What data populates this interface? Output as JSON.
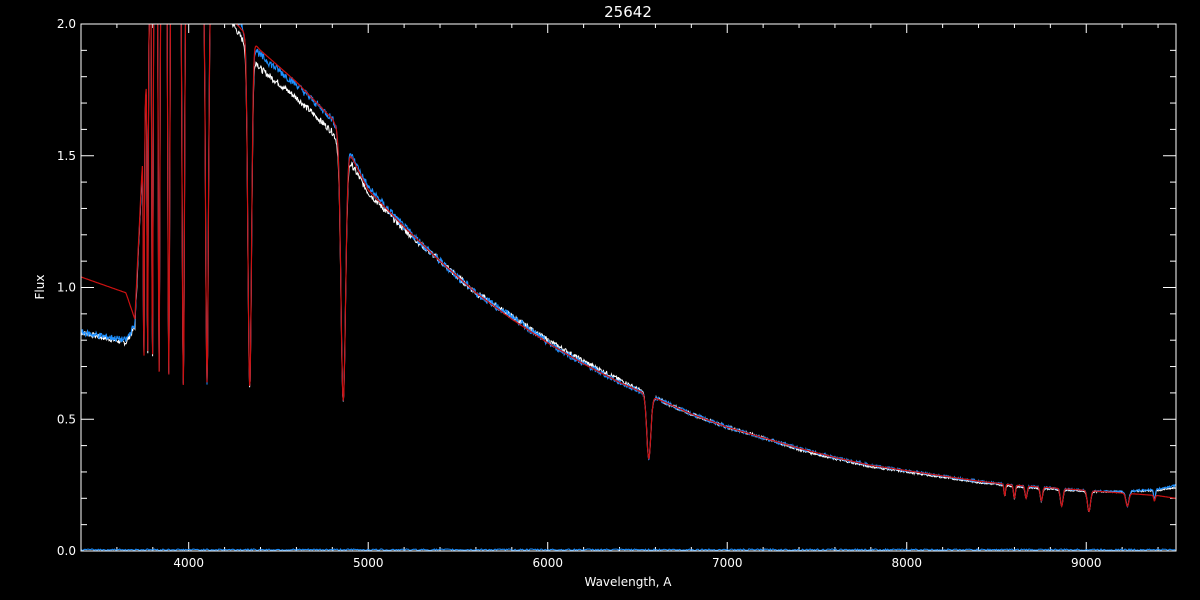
{
  "chart_data": {
    "type": "line",
    "title": "25642",
    "xlabel": "Wavelength, A",
    "ylabel": "Flux",
    "xlim": [
      3400,
      9500
    ],
    "ylim": [
      0.0,
      2.0
    ],
    "x_ticks": [
      4000,
      5000,
      6000,
      7000,
      8000,
      9000
    ],
    "x_tick_labels": [
      "4000",
      "5000",
      "6000",
      "7000",
      "8000",
      "9000"
    ],
    "x_minor_step": 200,
    "y_ticks": [
      0.0,
      0.5,
      1.0,
      1.5,
      2.0
    ],
    "y_tick_labels": [
      "0.0",
      "0.5",
      "1.0",
      "1.5",
      "2.0"
    ],
    "y_minor_step": 0.1,
    "grid": false,
    "colors": {
      "background": "#000000",
      "axes": "#ffffff",
      "observed": "#ffffff",
      "observed_corrected": "#1e90ff",
      "model": "#cc1111",
      "error": "#1e90ff"
    },
    "continuum": {
      "x": [
        3400,
        3650,
        3700,
        3800,
        4000,
        4200,
        4400,
        4600,
        4800,
        5000,
        5200,
        5400,
        5600,
        5800,
        6000,
        6200,
        6400,
        6600,
        6800,
        7000,
        7200,
        7400,
        7600,
        7800,
        8000,
        8200,
        8400,
        8600,
        8800,
        9000,
        9200,
        9400,
        9500
      ],
      "model": [
        1.04,
        0.98,
        0.88,
        2.3,
        2.3,
        2.05,
        1.9,
        1.78,
        1.64,
        1.37,
        1.23,
        1.1,
        0.98,
        0.88,
        0.79,
        0.71,
        0.64,
        0.58,
        0.52,
        0.47,
        0.43,
        0.39,
        0.355,
        0.325,
        0.305,
        0.285,
        0.265,
        0.25,
        0.24,
        0.23,
        0.22,
        0.21,
        0.2
      ],
      "observed": [
        0.83,
        0.79,
        0.85,
        2.3,
        2.3,
        2.05,
        1.83,
        1.72,
        1.59,
        1.36,
        1.22,
        1.1,
        0.98,
        0.89,
        0.8,
        0.72,
        0.65,
        0.58,
        0.52,
        0.47,
        0.43,
        0.385,
        0.35,
        0.32,
        0.3,
        0.28,
        0.26,
        0.245,
        0.235,
        0.225,
        0.225,
        0.23,
        0.24
      ],
      "observed_corrected": [
        0.83,
        0.8,
        0.86,
        2.3,
        2.3,
        2.08,
        1.88,
        1.77,
        1.64,
        1.38,
        1.23,
        1.1,
        0.98,
        0.89,
        0.79,
        0.71,
        0.64,
        0.58,
        0.52,
        0.47,
        0.43,
        0.39,
        0.355,
        0.325,
        0.305,
        0.285,
        0.265,
        0.25,
        0.24,
        0.23,
        0.225,
        0.235,
        0.25
      ]
    },
    "absorption_lines": [
      {
        "x": 3750,
        "min": 0.68,
        "w": 4
      },
      {
        "x": 3771,
        "min": 0.68,
        "w": 4
      },
      {
        "x": 3798,
        "min": 0.68,
        "w": 5
      },
      {
        "x": 3835,
        "min": 0.68,
        "w": 6
      },
      {
        "x": 3889,
        "min": 0.67,
        "w": 7
      },
      {
        "x": 3970,
        "min": 0.63,
        "w": 9
      },
      {
        "x": 4102,
        "min": 0.64,
        "w": 11
      },
      {
        "x": 4340,
        "min": 0.62,
        "w": 14
      },
      {
        "x": 4861,
        "min": 0.57,
        "w": 18
      },
      {
        "x": 6563,
        "min": 0.35,
        "w": 16
      },
      {
        "x": 8546,
        "min": 0.21,
        "w": 6
      },
      {
        "x": 8600,
        "min": 0.2,
        "w": 7
      },
      {
        "x": 8665,
        "min": 0.2,
        "w": 8
      },
      {
        "x": 8750,
        "min": 0.19,
        "w": 9
      },
      {
        "x": 8863,
        "min": 0.17,
        "w": 10
      },
      {
        "x": 9015,
        "min": 0.15,
        "w": 12
      },
      {
        "x": 9229,
        "min": 0.17,
        "w": 12
      },
      {
        "x": 9380,
        "min": 0.19,
        "w": 6
      }
    ],
    "error_level": 0.005
  }
}
